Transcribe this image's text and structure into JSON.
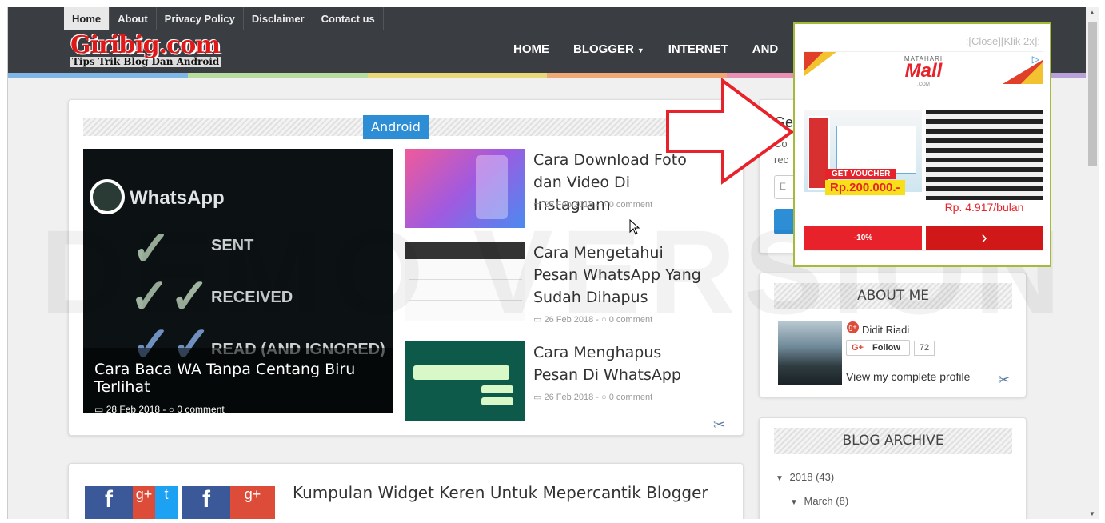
{
  "topnav": [
    "Home",
    "About",
    "Privacy Policy",
    "Disclaimer",
    "Contact us"
  ],
  "logo": {
    "main": "Giribig.com",
    "sub": "Tips Trik Blog Dan Android"
  },
  "mainnav": [
    "HOME",
    "BLOGGER",
    "INTERNET",
    "AND"
  ],
  "watermark": "DEMO VERSION",
  "featured": {
    "category": "Android",
    "big_post": {
      "title": "Cara Baca WA Tanpa Centang Biru Terlihat",
      "meta": "28 Feb 2018 - ",
      "comments": "0 comment",
      "image_text": {
        "app": "WhatsApp",
        "sent": "SENT",
        "received": "RECEIVED",
        "read": "READ (AND IGNORED)"
      }
    },
    "posts": [
      {
        "title": "Cara Download Foto dan Video Di Instagram",
        "meta": "26 Feb 2018 - ",
        "comments": "0 comment"
      },
      {
        "title": "Cara Mengetahui Pesan WhatsApp Yang Sudah Dihapus",
        "meta": "26 Feb 2018 - ",
        "comments": "0 comment"
      },
      {
        "title": "Cara Menghapus Pesan Di WhatsApp",
        "meta": "26 Feb 2018 - ",
        "comments": "0 comment"
      }
    ]
  },
  "second_post": {
    "title": "Kumpulan Widget Keren Untuk Mepercantik Blogger"
  },
  "sidebar": {
    "get_title": "Ge",
    "get_text1": "Co",
    "get_text2": "rec",
    "input_placeholder": "E",
    "about": {
      "title": "ABOUT ME",
      "name": "Didit Riadi",
      "follow": "Follow",
      "count": "72",
      "profile_link": "View my complete profile"
    },
    "archive": {
      "title": "BLOG ARCHIVE",
      "year": "2018",
      "year_count": "(43)",
      "month": "March",
      "month_count": "(8)"
    }
  },
  "ad": {
    "close_text": ":[Close][Klik 2x]:",
    "brand": "MATAHARI",
    "brand_logo": "Mall",
    "brand_sub": ".COM",
    "voucher": "GET VOUCHER",
    "voucher_amount": "Rp.200.000.-",
    "price": "Rp. 4.917/bulan",
    "discount": "-10%"
  },
  "colors": {
    "header": "#3a3d42",
    "badge": "#2d8ed6",
    "logo_red": "#e01818",
    "arrow": "#e8222a",
    "ad_border": "#a4bb3a"
  }
}
